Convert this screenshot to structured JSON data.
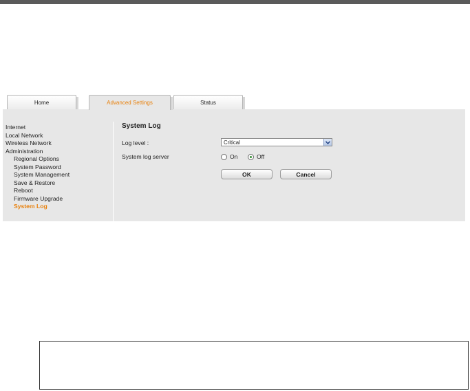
{
  "tabs": [
    {
      "label": "Home",
      "active": false
    },
    {
      "label": "Advanced Settings",
      "active": true
    },
    {
      "label": "Status",
      "active": false
    }
  ],
  "sidebar": {
    "items": [
      {
        "label": "Internet"
      },
      {
        "label": "Local Network"
      },
      {
        "label": "Wireless Network"
      },
      {
        "label": "Administration"
      }
    ],
    "subitems": [
      {
        "label": "Regional Options"
      },
      {
        "label": "System Password"
      },
      {
        "label": "System Management"
      },
      {
        "label": "Save & Restore"
      },
      {
        "label": "Reboot"
      },
      {
        "label": "Firmware Upgrade"
      },
      {
        "label": "System Log",
        "active": true
      }
    ]
  },
  "main": {
    "title": "System Log",
    "log_level_label": "Log level :",
    "log_level_value": "Critical",
    "server_label": "System log server",
    "radio_on": "On",
    "radio_off": "Off",
    "server_state": "Off",
    "ok_label": "OK",
    "cancel_label": "Cancel"
  },
  "colors": {
    "accent": "#e8800b",
    "panel_bg": "#e7e7e7",
    "top_bar": "#5a5a5a"
  }
}
